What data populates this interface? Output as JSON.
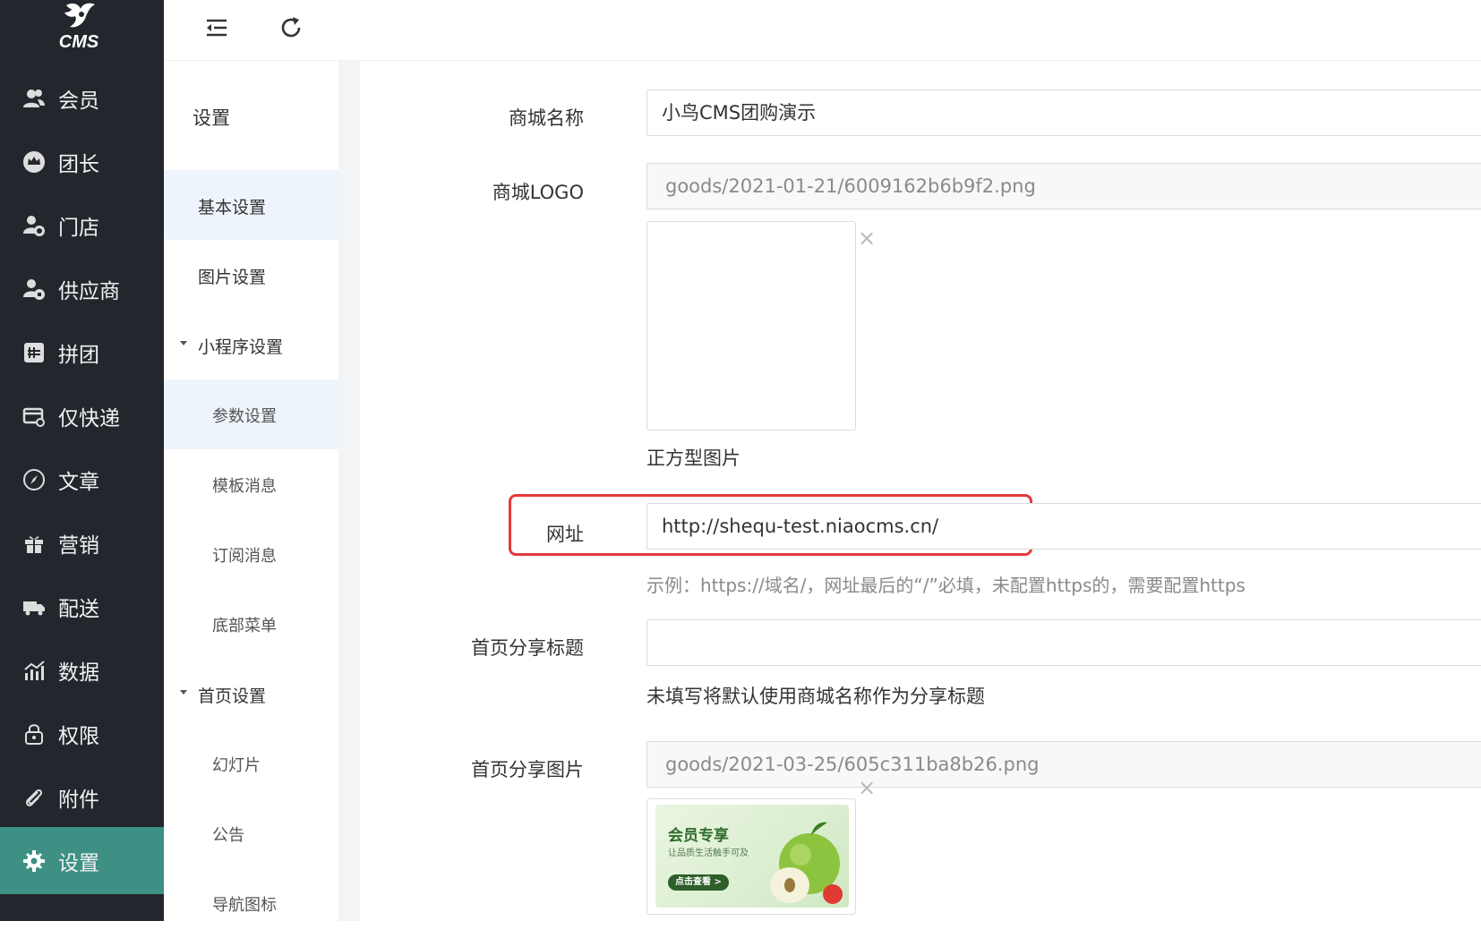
{
  "brand": {
    "logo_text": "CMS"
  },
  "nav": {
    "items": [
      {
        "label": "会员",
        "icon": "users-icon"
      },
      {
        "label": "团长",
        "icon": "crown-icon"
      },
      {
        "label": "门店",
        "icon": "store-user-icon"
      },
      {
        "label": "供应商",
        "icon": "supplier-icon"
      },
      {
        "label": "拼团",
        "icon": "group-buy-icon"
      },
      {
        "label": "仅快递",
        "icon": "delivery-icon"
      },
      {
        "label": "文章",
        "icon": "compass-icon"
      },
      {
        "label": "营销",
        "icon": "gift-icon"
      },
      {
        "label": "配送",
        "icon": "truck-icon"
      },
      {
        "label": "数据",
        "icon": "chart-icon"
      },
      {
        "label": "权限",
        "icon": "lock-icon"
      },
      {
        "label": "附件",
        "icon": "paperclip-icon"
      },
      {
        "label": "设置",
        "icon": "gear-icon",
        "active": true
      }
    ]
  },
  "topbar": {
    "collapse_icon": "menu-collapse-icon",
    "refresh_icon": "refresh-icon"
  },
  "submenu": {
    "title": "设置",
    "items": [
      {
        "label": "基本设置",
        "level": 1,
        "selected": true
      },
      {
        "label": "图片设置",
        "level": 1
      },
      {
        "label": "小程序设置",
        "level": 1,
        "expandable": true
      },
      {
        "label": "参数设置",
        "level": 2,
        "selected": true
      },
      {
        "label": "模板消息",
        "level": 2
      },
      {
        "label": "订阅消息",
        "level": 2
      },
      {
        "label": "底部菜单",
        "level": 2
      },
      {
        "label": "首页设置",
        "level": 1,
        "expandable": true
      },
      {
        "label": "幻灯片",
        "level": 2
      },
      {
        "label": "公告",
        "level": 2
      },
      {
        "label": "导航图标",
        "level": 2
      }
    ]
  },
  "form": {
    "shop_name": {
      "label": "商城名称",
      "value": "小鸟CMS团购演示"
    },
    "shop_logo": {
      "label": "商城LOGO",
      "value": "goods/2021-01-21/6009162b6b9f2.png",
      "help": "正方型图片",
      "remove": "×"
    },
    "site_url": {
      "label": "网址",
      "value": "http://shequ-test.niaocms.cn/",
      "help": "示例：https://域名/，网址最后的“/”必填，未配置https的，需要配置https"
    },
    "share_title": {
      "label": "首页分享标题",
      "value": "",
      "help": "未填写将默认使用商城名称作为分享标题"
    },
    "share_image": {
      "label": "首页分享图片",
      "value": "goods/2021-03-25/605c311ba8b26.png",
      "remove": "×",
      "preview": {
        "title": "会员专享",
        "subtitle": "让品质生活触手可及",
        "button": "点击查看 >"
      }
    }
  },
  "colors": {
    "nav_bg": "#23272d",
    "nav_active": "#3d9083",
    "submenu_selected": "#edf4fb",
    "highlight": "#e33a3a"
  }
}
